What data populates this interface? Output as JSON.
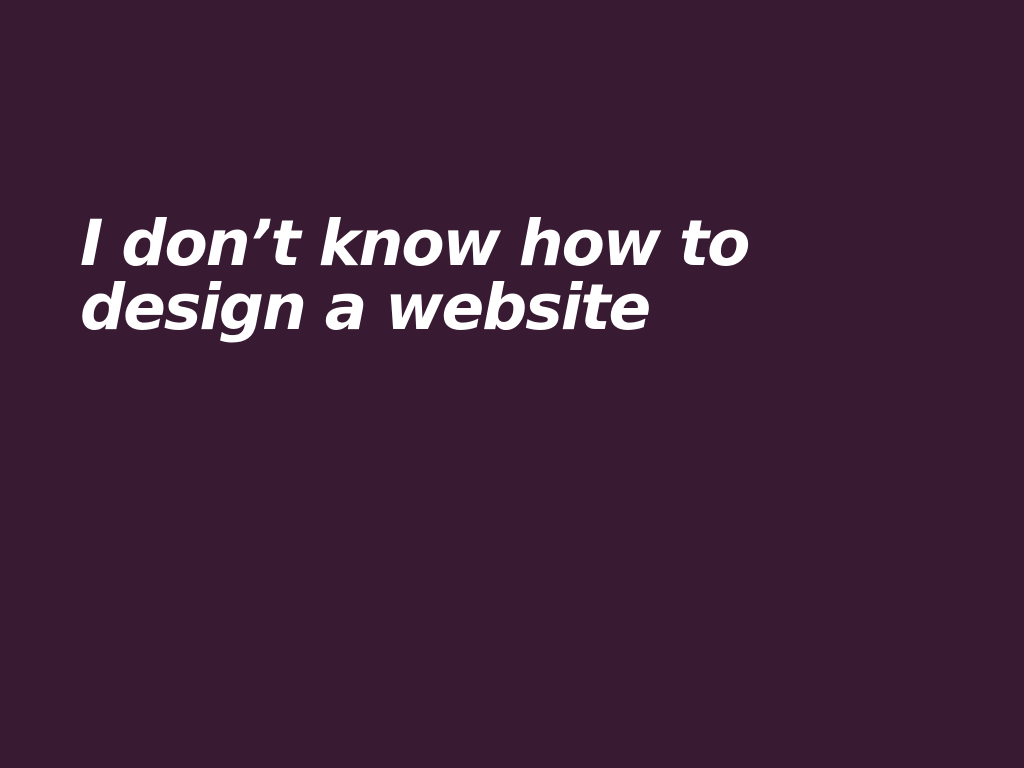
{
  "slide": {
    "background_color": "#381A33",
    "text_color": "#FFFFFF",
    "headline_lines": [
      "I don’t know how to",
      "design a website"
    ]
  }
}
